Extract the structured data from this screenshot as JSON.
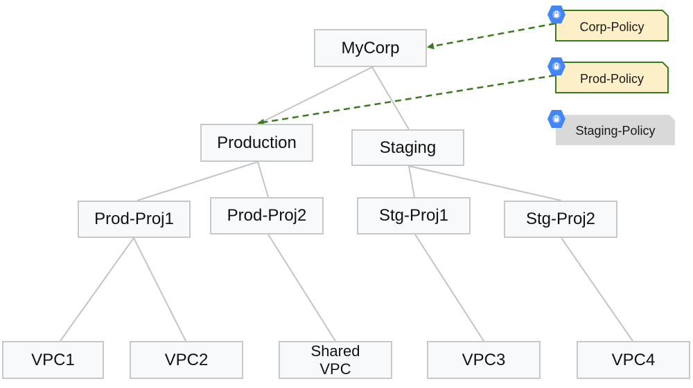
{
  "diagram": {
    "nodes": [
      {
        "id": "mycorp",
        "label": "MyCorp"
      },
      {
        "id": "production",
        "label": "Production"
      },
      {
        "id": "staging",
        "label": "Staging"
      },
      {
        "id": "prod-proj1",
        "label": "Prod-Proj1"
      },
      {
        "id": "prod-proj2",
        "label": "Prod-Proj2"
      },
      {
        "id": "stg-proj1",
        "label": "Stg-Proj1"
      },
      {
        "id": "stg-proj2",
        "label": "Stg-Proj2"
      },
      {
        "id": "vpc1",
        "label": "VPC1"
      },
      {
        "id": "vpc2",
        "label": "VPC2"
      },
      {
        "id": "shared-vpc",
        "label": "Shared\nVPC"
      },
      {
        "id": "vpc3",
        "label": "VPC3"
      },
      {
        "id": "vpc4",
        "label": "VPC4"
      }
    ],
    "edges": [
      [
        "mycorp",
        "production"
      ],
      [
        "mycorp",
        "staging"
      ],
      [
        "production",
        "prod-proj1"
      ],
      [
        "production",
        "prod-proj2"
      ],
      [
        "staging",
        "stg-proj1"
      ],
      [
        "staging",
        "stg-proj2"
      ],
      [
        "prod-proj1",
        "vpc1"
      ],
      [
        "prod-proj1",
        "vpc2"
      ],
      [
        "prod-proj2",
        "shared-vpc"
      ],
      [
        "stg-proj1",
        "vpc3"
      ],
      [
        "stg-proj2",
        "vpc4"
      ]
    ],
    "policies": [
      {
        "id": "corp-policy",
        "label": "Corp-Policy",
        "attached": true,
        "target": "mycorp",
        "icon": "security-shield-icon"
      },
      {
        "id": "prod-policy",
        "label": "Prod-Policy",
        "attached": true,
        "target": "production",
        "icon": "security-shield-icon"
      },
      {
        "id": "staging-policy",
        "label": "Staging-Policy",
        "attached": false,
        "icon": "security-shield-icon"
      }
    ],
    "colors": {
      "node_fill": "#f8f9fa",
      "node_border": "#c8c8c8",
      "edge": "#c4c4c4",
      "policy_attached_fill": "#fdefc8",
      "policy_attached_border": "#3a7a1e",
      "policy_detached_fill": "#d9d9d9",
      "policy_link": "#3a7a1e",
      "badge": "#4285f4"
    }
  }
}
